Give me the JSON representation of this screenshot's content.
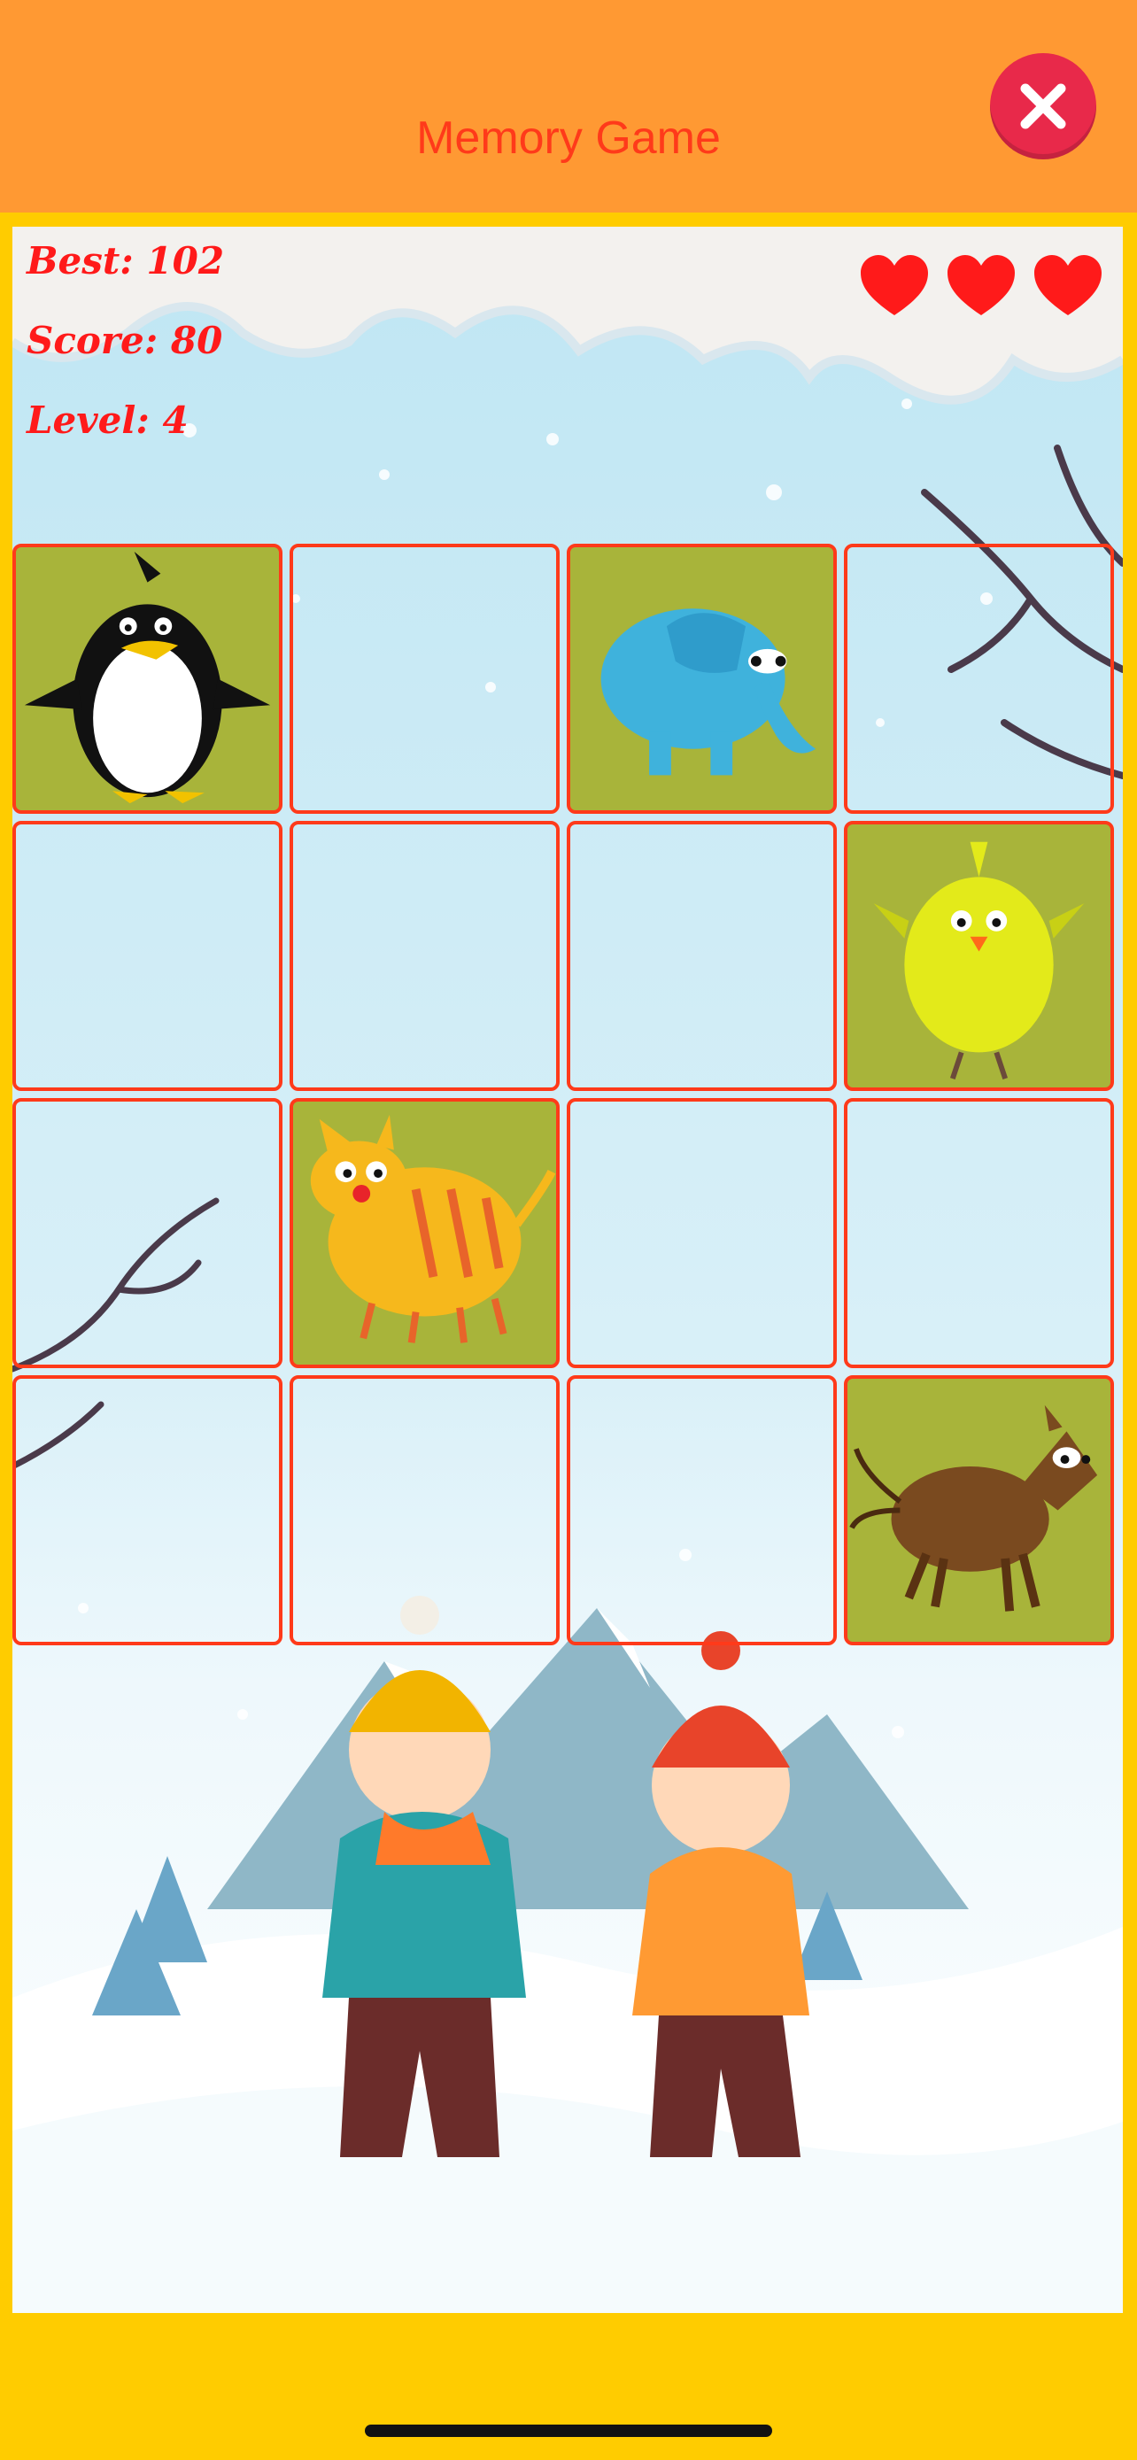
{
  "header": {
    "title": "Memory Game"
  },
  "stats": {
    "best": "Best: 102",
    "score": "Score: 80",
    "level": "Level: 4"
  },
  "lives": 3,
  "board": {
    "rows": 4,
    "cols": 4,
    "cards": [
      {
        "state": "open",
        "animal": "penguin"
      },
      {
        "state": "hidden",
        "animal": ""
      },
      {
        "state": "open",
        "animal": "elephant"
      },
      {
        "state": "hidden",
        "animal": ""
      },
      {
        "state": "hidden",
        "animal": ""
      },
      {
        "state": "hidden",
        "animal": ""
      },
      {
        "state": "hidden",
        "animal": ""
      },
      {
        "state": "open",
        "animal": "chick"
      },
      {
        "state": "hidden",
        "animal": ""
      },
      {
        "state": "open",
        "animal": "cat"
      },
      {
        "state": "hidden",
        "animal": ""
      },
      {
        "state": "hidden",
        "animal": ""
      },
      {
        "state": "hidden",
        "animal": ""
      },
      {
        "state": "hidden",
        "animal": ""
      },
      {
        "state": "hidden",
        "animal": ""
      },
      {
        "state": "open",
        "animal": "horse"
      }
    ]
  },
  "colors": {
    "header_bg": "#ff9933",
    "frame": "#ffcc00",
    "title_text": "#ff3a1a",
    "card_border": "#ff3a1a",
    "card_open_bg": "#a8b43a",
    "heart": "#ff1a1a",
    "close_button": "#e8294a"
  }
}
